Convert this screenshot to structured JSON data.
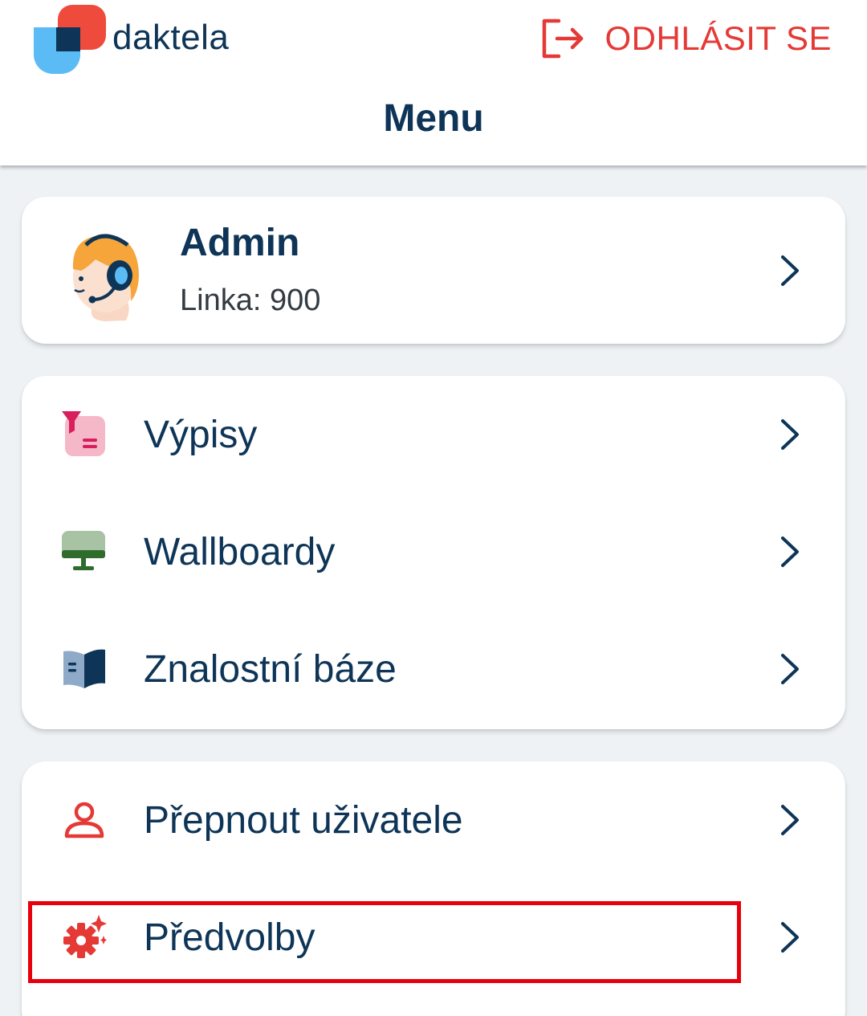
{
  "header": {
    "brand": "daktela",
    "logout_label": "ODHLÁSIT SE",
    "logout_icon": "logout-icon",
    "title": "Menu"
  },
  "profile": {
    "name": "Admin",
    "line": "Linka: 900",
    "avatar_icon": "agent-headset-avatar"
  },
  "menu_group_1": {
    "items": [
      {
        "label": "Výpisy",
        "icon": "filter-list-icon"
      },
      {
        "label": "Wallboardy",
        "icon": "monitor-icon"
      },
      {
        "label": "Znalostní báze",
        "icon": "book-icon"
      }
    ]
  },
  "menu_group_2": {
    "items": [
      {
        "label": "Přepnout uživatele",
        "icon": "user-icon"
      },
      {
        "label": "Předvolby",
        "icon": "gear-sparkle-icon"
      }
    ]
  },
  "colors": {
    "accent_red": "#e53935",
    "brand_navy": "#0e3557",
    "highlight": "#e8000d"
  }
}
